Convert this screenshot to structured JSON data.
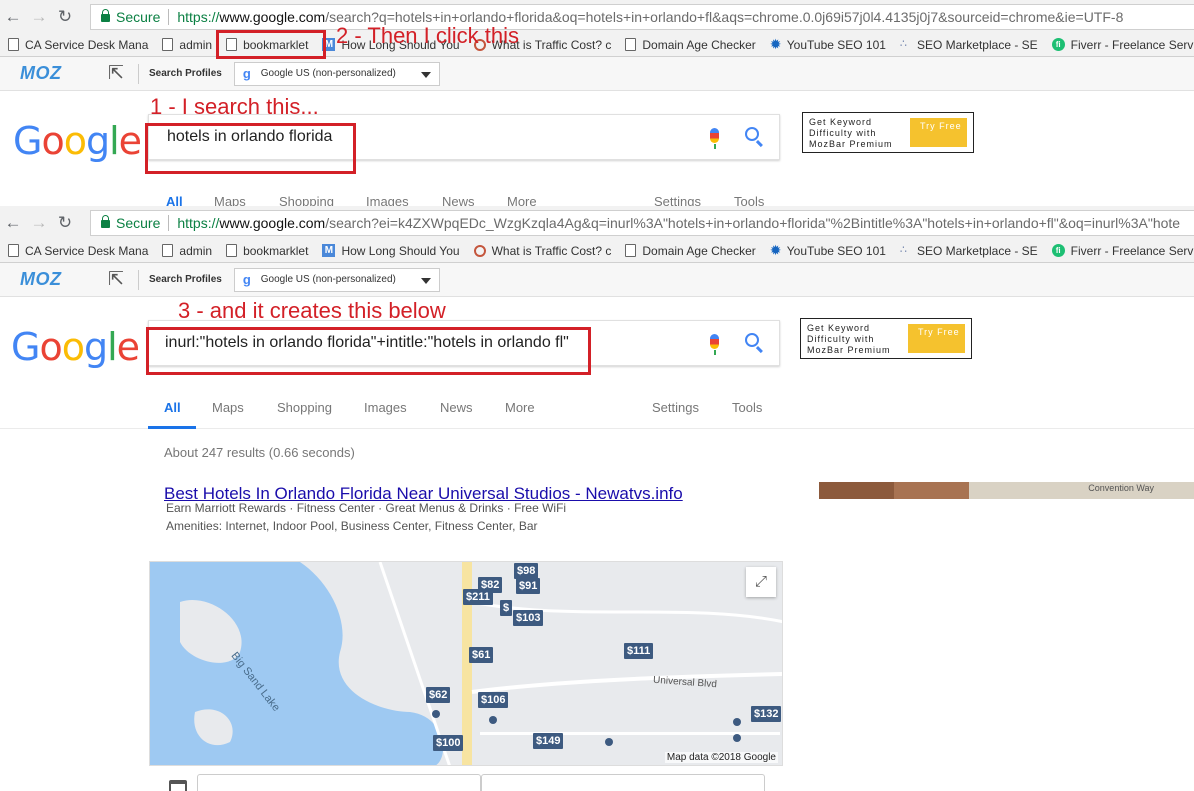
{
  "browser": {
    "secure_label": "Secure",
    "back_icon": "arrow-left-icon",
    "forward_icon": "arrow-right-icon",
    "reload_icon": "reload-icon"
  },
  "shot1": {
    "url_scheme": "https://",
    "url_host": "www.google.com",
    "url_path": "/search?q=hotels+in+orlando+florida&oq=hotels+in+orlando+fl&aqs=chrome.0.0j69i57j0l4.4135j0j7&sourceid=chrome&ie=UTF-8",
    "search_query": "hotels in orlando florida",
    "tabs": [
      "All",
      "Maps",
      "Shopping",
      "Images",
      "News",
      "More",
      "Settings",
      "Tools"
    ]
  },
  "shot2": {
    "url_scheme": "https://",
    "url_host": "www.google.com",
    "url_path": "/search?ei=k4ZXWpqEDc_WzgKzqla4Ag&q=inurl%3A\"hotels+in+orlando+florida\"%2Bintitle%3A\"hotels+in+orlando+fl\"&oq=inurl%3A\"hote",
    "search_query": "inurl:\"hotels in orlando florida\"+intitle:\"hotels in orlando fl\"",
    "tabs": [
      "All",
      "Maps",
      "Shopping",
      "Images",
      "News",
      "More",
      "Settings",
      "Tools"
    ],
    "result_stats": "About 247 results (0.66 seconds)",
    "result": {
      "title": "Best Hotels In Orlando Florida Near Universal Studios - Newatvs.info",
      "line1": "Earn Marriott Rewards · Fitness Center · Great Menus & Drinks · Free WiFi",
      "line2": "Amenities: Internet, Indoor Pool, Business Center, Fitness Center, Bar"
    },
    "side_photo_label": "Convention Way",
    "map": {
      "lake_label": "Big Sand Lake",
      "road_label": "Universal Blvd",
      "credit": "Map data ©2018 Google",
      "expand_icon": "expand-icon",
      "prices": [
        "$98",
        "$82",
        "$91",
        "$211",
        "$",
        "$103",
        "$61",
        "$111",
        "$62",
        "$106",
        "$132",
        "$100",
        "$149"
      ]
    },
    "calendar_icon": "calendar-icon"
  },
  "bookmarks": [
    {
      "label": "CA Service Desk Mana",
      "icon": "page-icon"
    },
    {
      "label": "admin",
      "icon": "page-icon"
    },
    {
      "label": "bookmarklet",
      "icon": "page-icon"
    },
    {
      "label": "How Long Should You",
      "icon": "moz-m-icon"
    },
    {
      "label": "What is Traffic Cost? c",
      "icon": "ring-icon"
    },
    {
      "label": "Domain Age Checker",
      "icon": "page-icon"
    },
    {
      "label": "YouTube SEO 101",
      "icon": "gear-blue-icon"
    },
    {
      "label": "SEO Marketplace - SE",
      "icon": "dots-icon"
    },
    {
      "label": "Fiverr - Freelance Serv",
      "icon": "fi-icon"
    }
  ],
  "mozbar": {
    "logo": "MOZ",
    "search_profiles_label": "Search Profiles",
    "profile_value": "Google US (non-personalized)",
    "profile_glyph": "g"
  },
  "google_logo": [
    "G",
    "o",
    "o",
    "g",
    "l",
    "e"
  ],
  "keyword_promo": {
    "text": "Get Keyword Difficulty with MozBar Premium",
    "button": "Try Free"
  },
  "annotations": {
    "step1": "1 - I search this...",
    "step2": "2 - Then I click this",
    "step3": "3 - and it creates this below"
  },
  "colors": {
    "annotation": "#d32027",
    "google_blue": "#4285f4",
    "link": "#1a0dab",
    "map_pin": "#3d5a80"
  }
}
